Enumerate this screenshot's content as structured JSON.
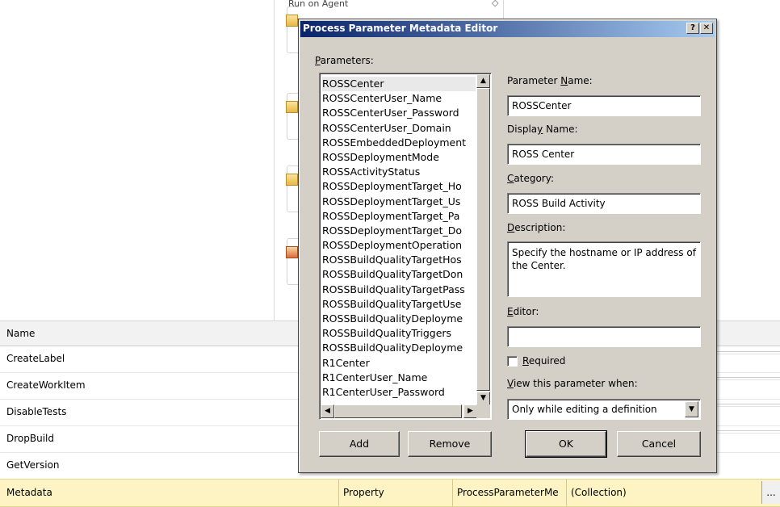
{
  "background": {
    "top_activity_label": "Run on Agent",
    "grid": {
      "header": "Name",
      "rows": [
        {
          "name": "CreateLabel"
        },
        {
          "name": "CreateWorkItem"
        },
        {
          "name": "DisableTests"
        },
        {
          "name": "DropBuild"
        },
        {
          "name": "GetVersion"
        },
        {
          "name": "Metadata",
          "type": "Property",
          "param_type": "ProcessParameterMe",
          "value": "(Collection)",
          "button": "..."
        }
      ]
    }
  },
  "dialog": {
    "title": "Process Parameter Metadata Editor",
    "help_btn": "?",
    "close_btn": "✕",
    "parameters_label_key": "P",
    "parameters_label_rest": "arameters:",
    "parameters": [
      "ROSSCenter",
      "ROSSCenterUser_Name",
      "ROSSCenterUser_Password",
      "ROSSCenterUser_Domain",
      "ROSSEmbeddedDeployment",
      "ROSSDeploymentMode",
      "ROSSActivityStatus",
      "ROSSDeploymentTarget_Ho",
      "ROSSDeploymentTarget_Us",
      "ROSSDeploymentTarget_Pa",
      "ROSSDeploymentTarget_Do",
      "ROSSDeploymentOperation",
      "ROSSBuildQualityTargetHos",
      "ROSSBuildQualityTargetDon",
      "ROSSBuildQualityTargetPass",
      "ROSSBuildQualityTargetUse",
      "ROSSBuildQualityDeployme",
      "ROSSBuildQualityTriggers",
      "ROSSBuildQualityDeployme",
      "R1Center",
      "R1CenterUser_Name",
      "R1CenterUser_Password"
    ],
    "param_name_label_a": "Parameter ",
    "param_name_label_key": "N",
    "param_name_label_b": "ame:",
    "param_name_value": "ROSSCenter",
    "display_name_label_a": "Displa",
    "display_name_label_key": "y",
    "display_name_label_b": " Name:",
    "display_name_value": "ROSS Center",
    "category_label_key": "C",
    "category_label_rest": "ategory:",
    "category_value": "ROSS Build Activity",
    "description_label_key": "D",
    "description_label_rest": "escription:",
    "description_value": "Specify the hostname or IP address of the Center.",
    "editor_label_key": "E",
    "editor_label_rest": "ditor:",
    "editor_value": "",
    "required_label_key": "R",
    "required_label_rest": "equired",
    "required_checked": false,
    "view_when_label_key": "V",
    "view_when_label_rest": "iew this parameter when:",
    "view_when_value": "Only while editing a definition",
    "add_button": "Add",
    "remove_button": "Remove",
    "ok_button": "OK",
    "cancel_button": "Cancel"
  }
}
